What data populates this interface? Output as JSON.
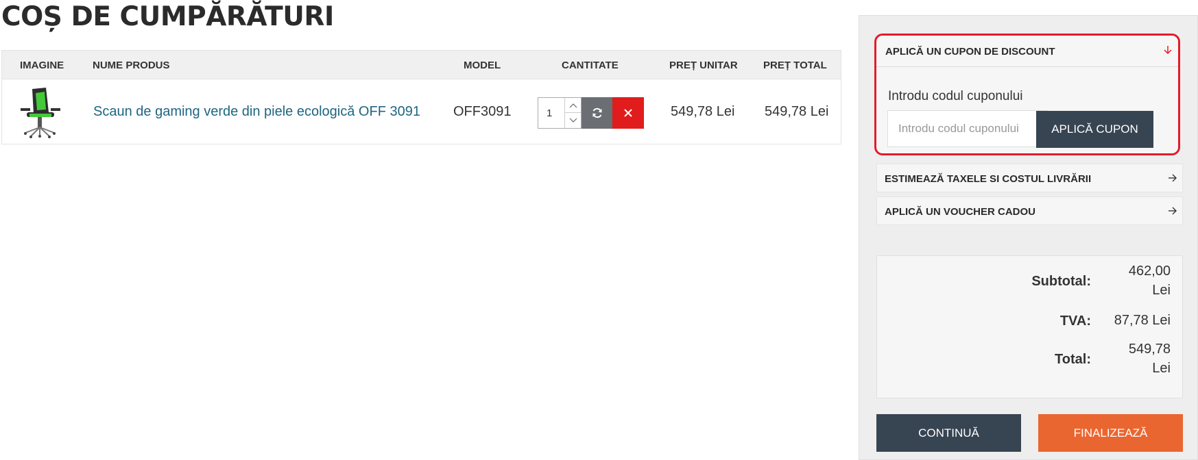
{
  "page": {
    "title": "COȘ DE CUMPĂRĂTURI"
  },
  "cart": {
    "headers": {
      "image": "IMAGINE",
      "name": "NUME PRODUS",
      "model": "MODEL",
      "quantity": "CANTITATE",
      "unit_price": "PREȚ UNITAR",
      "total_price": "PREȚ TOTAL"
    },
    "items": [
      {
        "name": "Scaun de gaming verde din piele ecologică OFF 3091",
        "model": "OFF3091",
        "quantity": "1",
        "unit_price": "549,78 Lei",
        "total_price": "549,78 Lei",
        "image_icon": "gaming-chair-image"
      }
    ]
  },
  "sidebar": {
    "coupon": {
      "heading": "APLICĂ UN CUPON DE DISCOUNT",
      "label": "Introdu codul cuponului",
      "placeholder": "Introdu codul cuponului",
      "value": "",
      "button": "APLICĂ CUPON"
    },
    "shipping": {
      "heading": "ESTIMEAZĂ TAXELE SI COSTUL LIVRĂRII"
    },
    "voucher": {
      "heading": "APLICĂ UN VOUCHER CADOU"
    },
    "totals": {
      "subtotal_label": "Subtotal:",
      "subtotal_value": "462,00 Lei",
      "tva_label": "TVA:",
      "tva_value": "87,78 Lei",
      "total_label": "Total:",
      "total_value": "549,78 Lei"
    },
    "continue_button": "CONTINUĂ",
    "checkout_button": "FINALIZEAZĂ"
  },
  "colors": {
    "primary_dark": "#374452",
    "checkout_orange": "#ea6630",
    "remove_red": "#e01c1c",
    "highlight_red": "#e41b2a",
    "link_blue": "#1e6580"
  }
}
